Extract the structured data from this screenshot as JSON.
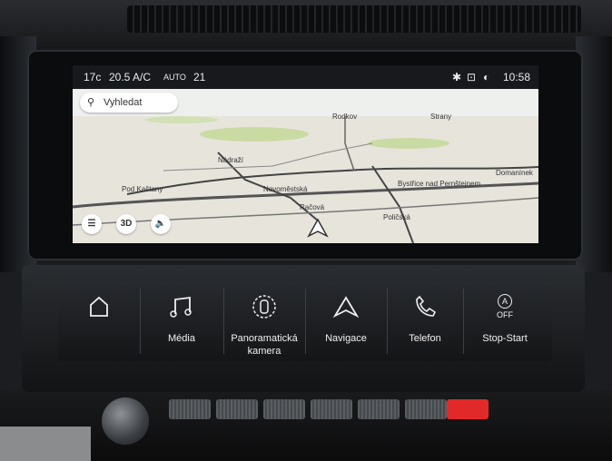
{
  "status_bar": {
    "temp_outside": "17c",
    "climate_temp": "20.5 A/C",
    "climate_mode": "AUTO",
    "climate_temp_right": "21",
    "clock": "10:58"
  },
  "map": {
    "search_placeholder": "Vyhledat",
    "places": [
      "Rodkov",
      "Strany",
      "Nádraží",
      "Pod Kaštany",
      "Novoměstská",
      "Bystřice nad Pernštejnem",
      "Domanínek",
      "Račová",
      "Poličská"
    ],
    "controls": {
      "view_3d": "3D"
    }
  },
  "menu": [
    {
      "label": "",
      "icon": "home-icon"
    },
    {
      "label": "Média",
      "icon": "music-note-icon"
    },
    {
      "label": "Panoramatická kamera",
      "icon": "camera-car-icon"
    },
    {
      "label": "Navigace",
      "icon": "navigation-arrow-icon"
    },
    {
      "label": "Telefon",
      "icon": "phone-icon"
    },
    {
      "label": "Stop-Start",
      "icon": "stop-start-icon",
      "state_text": "A",
      "off_text": "OFF"
    }
  ]
}
